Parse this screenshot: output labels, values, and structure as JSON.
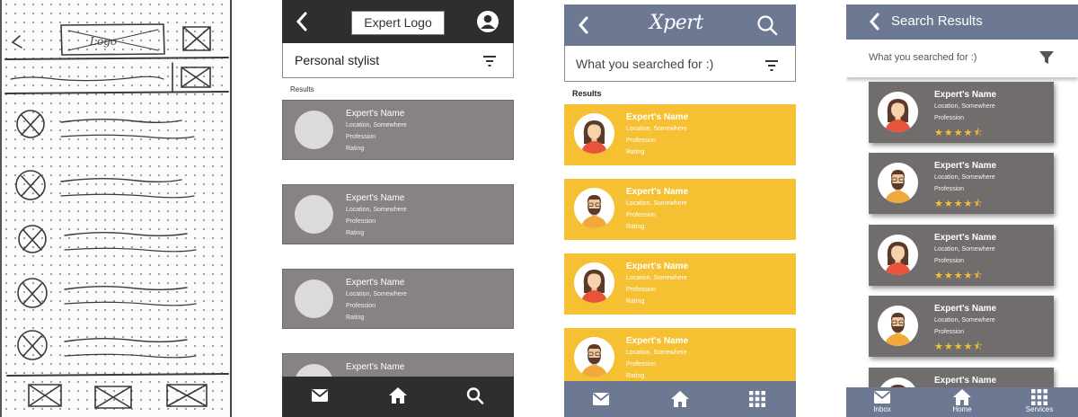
{
  "wireframe": {
    "logo": "Expert Logo",
    "search_text": "Personal stylist",
    "results_label": "Results",
    "cards": [
      {
        "name": "Expert's Name",
        "location": "Location, Somewhere",
        "profession": "Profession",
        "rating": "Rating"
      },
      {
        "name": "Expert's Name",
        "location": "Location, Somewhere",
        "profession": "Profession",
        "rating": "Rating"
      },
      {
        "name": "Expert's Name",
        "location": "Location, Somewhere",
        "profession": "Profession",
        "rating": "Rating"
      },
      {
        "name": "Expert's Name"
      }
    ]
  },
  "colored": {
    "logo": "Xpert",
    "search_text": "What you searched for :)",
    "results_label": "Results",
    "colors": {
      "header": "#6d7892",
      "card": "#f5c032"
    },
    "cards": [
      {
        "name": "Expert's Name",
        "location": "Location, Somewhere",
        "profession": "Profession",
        "rating": "Rating",
        "avatar": "female-avatar-icon"
      },
      {
        "name": "Expert's Name",
        "location": "Location, Somewhere",
        "profession": "Profession",
        "rating": "Rating",
        "avatar": "male-avatar-icon"
      },
      {
        "name": "Expert's Name",
        "location": "Location, Somewhere",
        "profession": "Profession",
        "rating": "Rating",
        "avatar": "female-avatar-icon"
      },
      {
        "name": "Expert's Name",
        "location": "Location, Somewhere",
        "profession": "Profession",
        "rating": "Rating",
        "avatar": "male-avatar-icon"
      }
    ]
  },
  "final": {
    "title": "Search Results",
    "search_text": "What you searched for :)",
    "colors": {
      "header": "#6d7892",
      "card": "#716d6d",
      "star": "#f5c032"
    },
    "cards": [
      {
        "name": "Expert's Name",
        "location": "Location, Somewhere",
        "profession": "Profession",
        "stars": "★★★★⯪",
        "rating_value": 4.5,
        "avatar": "female-avatar-icon"
      },
      {
        "name": "Expert's Name",
        "location": "Location, Somewhere",
        "profession": "Profession",
        "stars": "★★★★⯪",
        "rating_value": 4.5,
        "avatar": "male-avatar-icon"
      },
      {
        "name": "Expert's Name",
        "location": "Location, Somewhere",
        "profession": "Profession",
        "stars": "★★★★⯪",
        "rating_value": 4.5,
        "avatar": "female-avatar-icon"
      },
      {
        "name": "Expert's Name",
        "location": "Location, Somewhere",
        "profession": "Profession",
        "stars": "★★★★⯪",
        "rating_value": 4.5,
        "avatar": "male-avatar-icon"
      },
      {
        "name": "Expert's Name"
      }
    ],
    "nav": {
      "inbox": "Inbox",
      "home": "Home",
      "services": "Services"
    }
  }
}
